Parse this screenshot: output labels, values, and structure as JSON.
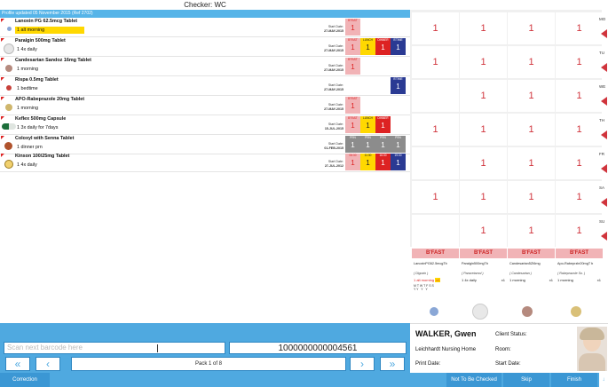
{
  "header": {
    "title": "Checker: WC"
  },
  "profile": {
    "text": "Profile updated 05 November 2015 (Ref 2702)"
  },
  "start_label": "Start Date:",
  "medications": [
    {
      "name": "Lanoxin PG 62.5mcg Tablet",
      "dose": "1 alt morning",
      "start": "27-MAY-2015",
      "pill": "blue-dot",
      "slots": [
        {
          "label": "B'FAST",
          "val": "1",
          "color": "#f1b3b6",
          "text": "#d22"
        }
      ]
    },
    {
      "name": "Paralgin 500mg Tablet",
      "dose": "1 4x daily",
      "start": "27-MAY-2015",
      "pill": "white-large",
      "slots": [
        {
          "label": "B'FAST",
          "val": "1",
          "color": "#f1b3b6",
          "text": "#d22"
        },
        {
          "label": "LUNCH",
          "val": "1",
          "color": "#ffd800",
          "text": "#222"
        },
        {
          "label": "DINNER",
          "val": "1",
          "color": "#d22",
          "text": "#fff"
        },
        {
          "label": "B'TIME",
          "val": "1",
          "color": "#2a3a93",
          "text": "#fff"
        }
      ]
    },
    {
      "name": "Candesartan Sandoz 16mg Tablet",
      "dose": "1 morning",
      "start": "27-MAY-2015",
      "pill": "pink",
      "slots": [
        {
          "label": "B'FAST",
          "val": "1",
          "color": "#f1b3b6",
          "text": "#d22"
        }
      ]
    },
    {
      "name": "Rispa 0.5mg Tablet",
      "dose": "1 bedtime",
      "start": "27-MAY-2015",
      "pill": "red",
      "slots": [
        {
          "label": "B'TIME",
          "val": "1",
          "color": "#2a3a93",
          "text": "#fff"
        }
      ]
    },
    {
      "name": "APO-Rabeprazole 20mg Tablet",
      "dose": "1 morning",
      "start": "27-MAY-2015",
      "pill": "yellow",
      "slots": [
        {
          "label": "B'FAST",
          "val": "1",
          "color": "#f1b3b6",
          "text": "#d22"
        }
      ]
    },
    {
      "name": "Keflex 500mg Capsule",
      "dose": "1 3x daily for 7days",
      "start": "15-JUL-2015",
      "pill": "capsule",
      "slots": [
        {
          "label": "B'FAST",
          "val": "1",
          "color": "#f1b3b6",
          "text": "#d22"
        },
        {
          "label": "LUNCH",
          "val": "1",
          "color": "#ffd800",
          "text": "#222"
        },
        {
          "label": "DINNER",
          "val": "1",
          "color": "#d22",
          "text": "#fff"
        }
      ]
    },
    {
      "name": "Coloxyl with Senna Tablet",
      "dose": "1 dinner prn",
      "start": "01-FEB-2015",
      "pill": "brown",
      "slots": [
        {
          "label": "PRN",
          "val": "1",
          "color": "#8c8c8c",
          "text": "#fff"
        },
        {
          "label": "PRN",
          "val": "1",
          "color": "#8c8c8c",
          "text": "#fff"
        },
        {
          "label": "PRN",
          "val": "1",
          "color": "#8c8c8c",
          "text": "#fff"
        },
        {
          "label": "PRN",
          "val": "1",
          "color": "#8c8c8c",
          "text": "#fff"
        }
      ]
    },
    {
      "name": "Kinson 100/25mg Tablet",
      "dose": "1 4x daily",
      "start": "27-JUL-2012",
      "pill": "yellow-cross",
      "slots": [
        {
          "label": "06:30",
          "val": "1",
          "color": "#f1b3b6",
          "text": "#d22"
        },
        {
          "label": "11:30",
          "val": "1",
          "color": "#ffd800",
          "text": "#222"
        },
        {
          "label": "16:30",
          "val": "1",
          "color": "#d22",
          "text": "#fff"
        },
        {
          "label": "19:30",
          "val": "1",
          "color": "#2a3a93",
          "text": "#fff"
        }
      ]
    }
  ],
  "grid_value": "1",
  "days": [
    "MO",
    "TU",
    "WE",
    "TH",
    "FR",
    "SA",
    "SU"
  ],
  "cards": [
    {
      "header": "B'FAST",
      "name": "LanoxinPG62.5mcgTb",
      "generic": "( Digoxin )",
      "dose": "1 alt morning",
      "qty": "x1",
      "red": true,
      "week": "M T W T F S S\nY Y   Y   Y"
    },
    {
      "header": "B'FAST",
      "name": "Paralgin500mgTb",
      "generic": "( Paracetamol )",
      "dose": "1 4x daily",
      "qty": "x1",
      "red": false,
      "week": ""
    },
    {
      "header": "B'FAST",
      "name": "Candesartan5ZI6mg",
      "generic": "( Candesartan )",
      "dose": "1 morning",
      "qty": "x1",
      "red": false,
      "week": ""
    },
    {
      "header": "B'FAST",
      "name": "Apo-Rabeprzle20mgT b",
      "generic": "( Rabeprazole So. )",
      "dose": "1 morning",
      "qty": "x1",
      "red": false,
      "week": ""
    }
  ],
  "scan": {
    "placeholder": "Scan next barcode here",
    "barcode": "1000000000004561",
    "pack": "Pack 1 of 8"
  },
  "patient": {
    "name": "WALKER, Gwen",
    "home": "Leichhardt Nursing Home",
    "status_label": "Client Status:",
    "room_label": "Room:",
    "print_label": "Print Date:",
    "start_label": "Start Date:"
  },
  "footer": {
    "correction": "Correction",
    "not_checked": "Not To Be Checked",
    "skip": "Skip",
    "finish": "Finish"
  }
}
